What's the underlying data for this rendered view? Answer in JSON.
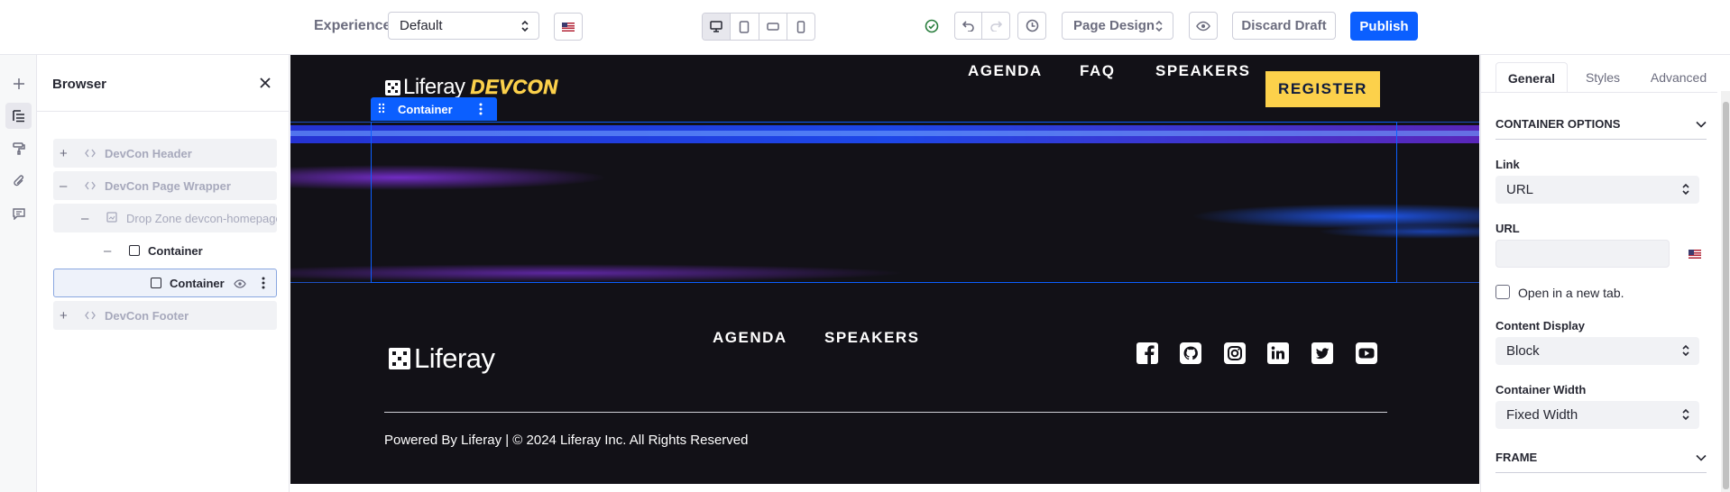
{
  "toolbar": {
    "experience_label": "Experience",
    "experience_value": "Default",
    "page_design_label": "Page Design",
    "discard_label": "Discard Draft",
    "publish_label": "Publish",
    "check_color": "#287d3c",
    "publish_color": "#0b5fff"
  },
  "rail": {
    "items": [
      "add-icon",
      "browser-icon",
      "page-design-icon",
      "mappings-icon",
      "comments-icon"
    ]
  },
  "browser": {
    "title": "Browser",
    "items": [
      {
        "label": "DevCon Header",
        "toggle": "+"
      },
      {
        "label": "DevCon Page Wrapper",
        "toggle": "–"
      },
      {
        "label": "Drop Zone devcon-homepage-content",
        "toggle": "–"
      },
      {
        "label": "Container",
        "toggle": "–"
      },
      {
        "label": "Container"
      },
      {
        "label": "DevCon Footer",
        "toggle": "+"
      }
    ]
  },
  "canvas": {
    "logo_text": "Liferay",
    "devcon_text": "DEVCON",
    "nav": [
      "AGENDA",
      "FAQ",
      "SPEAKERS"
    ],
    "register_label": "REGISTER",
    "container_tag": "Container",
    "footer_logo_text": "Liferay",
    "footer_nav": [
      "AGENDA",
      "SPEAKERS"
    ],
    "social_icons": [
      "facebook-icon",
      "github-icon",
      "instagram-icon",
      "linkedin-icon",
      "twitter-icon",
      "youtube-icon"
    ],
    "copyright": "Powered By Liferay | © 2024 Liferay Inc. All Rights Reserved",
    "accent_yellow": "#fcd14b",
    "background": "#121117"
  },
  "panel": {
    "tabs": [
      "General",
      "Styles",
      "Advanced"
    ],
    "active_tab": "General",
    "section_container": "CONTAINER OPTIONS",
    "link_label": "Link",
    "link_value": "URL",
    "url_label": "URL",
    "url_value": "",
    "new_tab_label": "Open in a new tab.",
    "content_display_label": "Content Display",
    "content_display_value": "Block",
    "container_width_label": "Container Width",
    "container_width_value": "Fixed Width",
    "section_frame": "FRAME"
  }
}
